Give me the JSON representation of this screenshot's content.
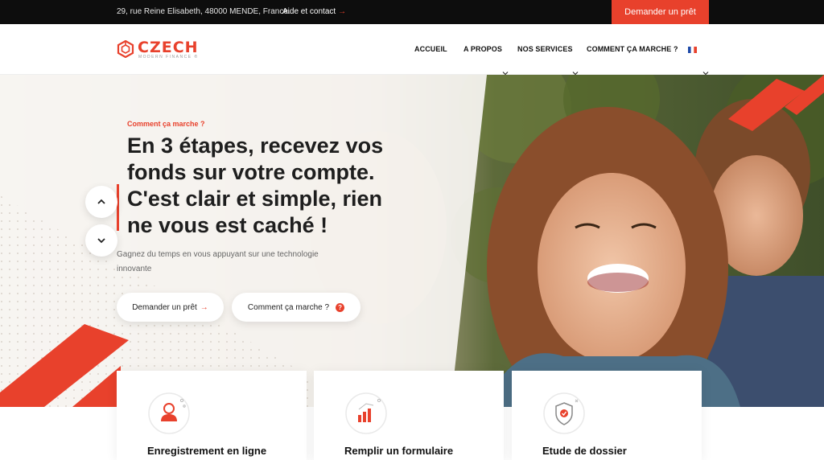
{
  "topbar": {
    "address": "29, rue Reine Elisabeth, 48000 MENDE, France.",
    "contact_label": "Aide et contact",
    "contact_arrow": "→",
    "cta_label": "Demander un prêt"
  },
  "header": {
    "logo_text": "CZECH",
    "logo_tagline": "MODERN FINANCE ®",
    "nav": [
      {
        "label": "ACCUEIL"
      },
      {
        "label": "A PROPOS"
      },
      {
        "label": "NOS SERVICES"
      },
      {
        "label": "COMMENT ÇA MARCHE ?"
      }
    ],
    "language_flag": "flag-fr-icon"
  },
  "hero": {
    "eyebrow": "Comment ça marche ?",
    "headline": "En 3 étapes, recevez vos fonds sur votre compte. C'est clair et simple, rien ne vous est caché !",
    "subtitle": "Gagnez du temps en vous appuyant sur une technologie innovante",
    "primary_button": "Demander un prêt",
    "primary_arrow": "→",
    "secondary_button": "Comment ça marche ?",
    "secondary_icon": "?"
  },
  "cards": [
    {
      "title": "Enregistrement en ligne",
      "icon": "user-icon"
    },
    {
      "title": "Remplir un formulaire",
      "icon": "bar-chart-icon"
    },
    {
      "title": "Etude de dossier",
      "icon": "shield-check-icon"
    }
  ],
  "colors": {
    "accent": "#e8412c",
    "topbar_bg": "#0d0d0d",
    "text_dark": "#1e1e1e"
  }
}
